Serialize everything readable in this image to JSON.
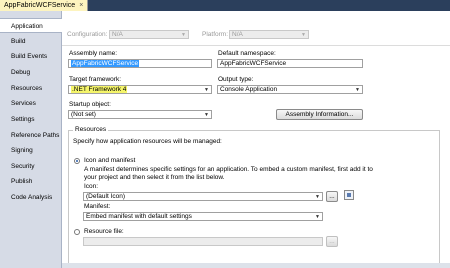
{
  "tab": {
    "title": "AppFabricWCFService",
    "close": "×"
  },
  "sidebar": {
    "items": [
      {
        "label": "Application"
      },
      {
        "label": "Build"
      },
      {
        "label": "Build Events"
      },
      {
        "label": "Debug"
      },
      {
        "label": "Resources"
      },
      {
        "label": "Services"
      },
      {
        "label": "Settings"
      },
      {
        "label": "Reference Paths"
      },
      {
        "label": "Signing"
      },
      {
        "label": "Security"
      },
      {
        "label": "Publish"
      },
      {
        "label": "Code Analysis"
      }
    ]
  },
  "config": {
    "configuration_label": "Configuration:",
    "configuration_value": "N/A",
    "platform_label": "Platform:",
    "platform_value": "N/A"
  },
  "form": {
    "assembly_name_label": "Assembly name:",
    "assembly_name_value": "AppFabricWCFService",
    "default_namespace_label": "Default namespace:",
    "default_namespace_value": "AppFabricWCFService",
    "target_framework_label": "Target framework:",
    "target_framework_value": ".NET Framework 4",
    "output_type_label": "Output type:",
    "output_type_value": "Console Application",
    "startup_object_label": "Startup object:",
    "startup_object_value": "(Not set)",
    "assembly_info_button": "Assembly Information..."
  },
  "resources": {
    "group_title": "Resources",
    "intro": "Specify how application resources will be managed:",
    "icon_manifest_label": "Icon and manifest",
    "desc_line1": "A manifest determines specific settings for an application. To embed a custom manifest, first add it to",
    "desc_line2": "your project and then select it from the list below.",
    "icon_label": "Icon:",
    "icon_value": "(Default Icon)",
    "browse": "...",
    "manifest_label": "Manifest:",
    "manifest_value": "Embed manifest with default settings",
    "resource_file_label": "Resource file:",
    "resource_file_browse": "..."
  }
}
